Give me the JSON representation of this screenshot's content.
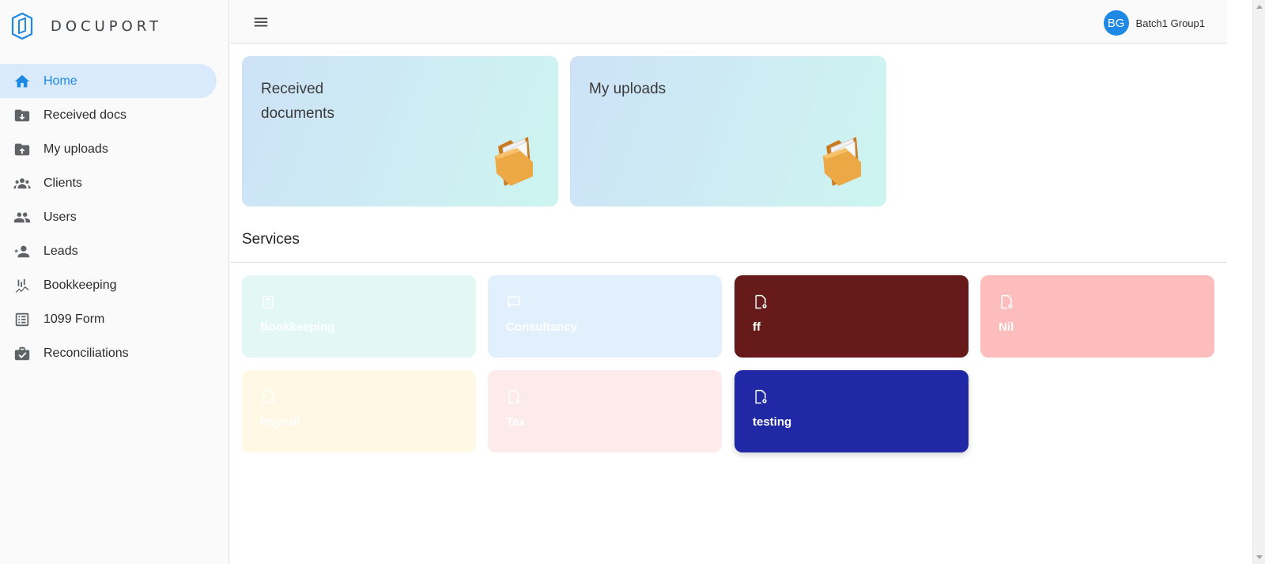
{
  "brand": {
    "name": "DOCUPORT"
  },
  "sidebar": {
    "items": [
      {
        "label": "Home",
        "icon": "home-icon",
        "active": true
      },
      {
        "label": "Received docs",
        "icon": "folder-download-icon"
      },
      {
        "label": "My uploads",
        "icon": "folder-upload-icon"
      },
      {
        "label": "Clients",
        "icon": "groups-icon"
      },
      {
        "label": "Users",
        "icon": "people-icon"
      },
      {
        "label": "Leads",
        "icon": "person-star-icon"
      },
      {
        "label": "Bookkeeping",
        "icon": "chart-icon"
      },
      {
        "label": "1099 Form",
        "icon": "list-form-icon"
      },
      {
        "label": "Reconciliations",
        "icon": "briefcase-check-icon"
      }
    ]
  },
  "header": {
    "menu_icon": "hamburger-menu-icon",
    "user": {
      "initials": "BG",
      "name": "Batch1 Group1",
      "avatar_color": "#1e88e5"
    }
  },
  "cards": [
    {
      "title": "Received documents",
      "icon": "folder-icon"
    },
    {
      "title": "My uploads",
      "icon": "folder-icon"
    }
  ],
  "services_section": {
    "title": "Services"
  },
  "services": [
    {
      "label": "Bookkeeping",
      "icon": "calculator-icon",
      "color": "#e3f7f5"
    },
    {
      "label": "Consultancy",
      "icon": "chat-icon",
      "color": "#e2effd"
    },
    {
      "label": "ff",
      "icon": "file-settings-icon",
      "color": "#661a1a"
    },
    {
      "label": "Nil",
      "icon": "file-settings-icon",
      "color": "#fdbdbd"
    },
    {
      "label": "Payroll",
      "icon": "file-settings-icon",
      "color": "#fef8e5"
    },
    {
      "label": "Tax",
      "icon": "file-settings-icon",
      "color": "#fdeaea"
    },
    {
      "label": "testing",
      "icon": "file-settings-icon",
      "color": "#2128a5"
    }
  ],
  "colors": {
    "accent": "#1e88e5",
    "active_nav_bg": "#d8eafc"
  }
}
